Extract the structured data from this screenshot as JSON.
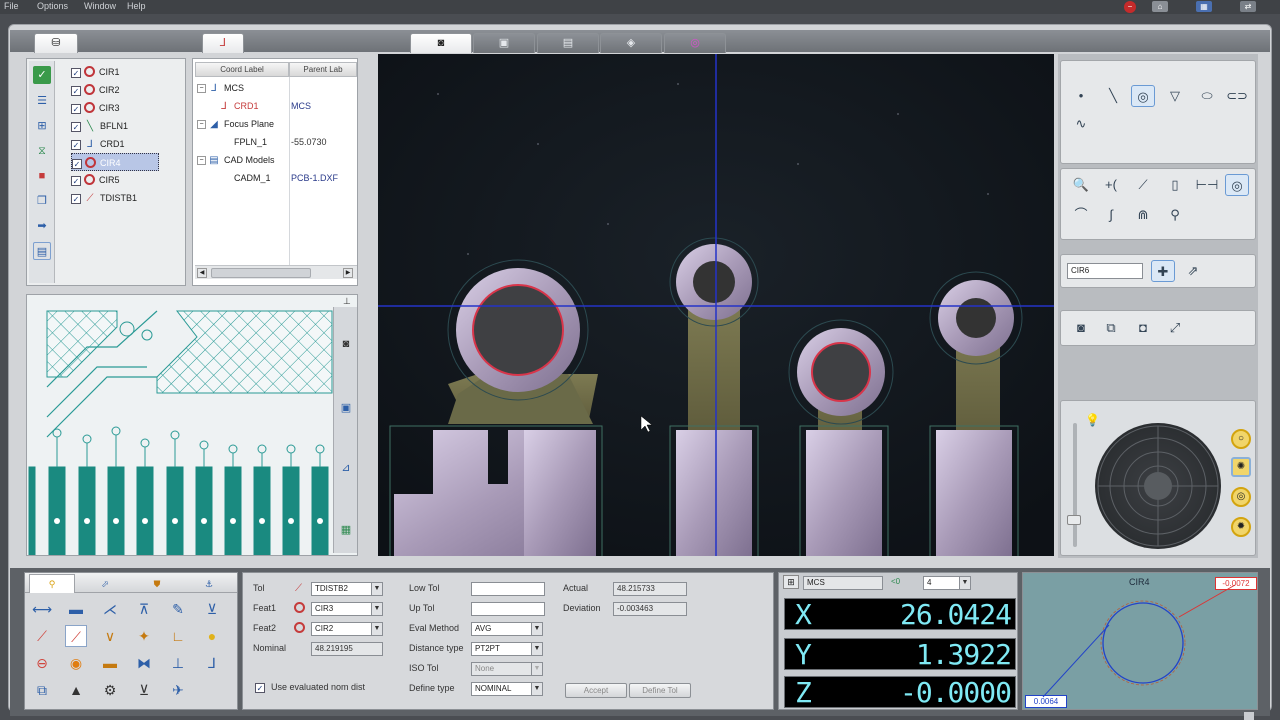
{
  "menu": {
    "items": [
      "File",
      "Options",
      "Window",
      "Help"
    ]
  },
  "left_tabs": [
    "features",
    "coords"
  ],
  "feature_list": [
    {
      "label": "CIR1",
      "type": "circle",
      "checked": true
    },
    {
      "label": "CIR2",
      "type": "circle",
      "checked": true
    },
    {
      "label": "CIR3",
      "type": "circle",
      "checked": true
    },
    {
      "label": "BFLN1",
      "type": "line",
      "checked": true
    },
    {
      "label": "CRD1",
      "type": "coord",
      "checked": true
    },
    {
      "label": "CIR4",
      "type": "circle",
      "checked": true,
      "selected": true
    },
    {
      "label": "CIR5",
      "type": "circle",
      "checked": true
    },
    {
      "label": "TDISTB1",
      "type": "distance",
      "checked": true
    }
  ],
  "coord_table": {
    "headers": [
      "Coord Label",
      "Parent Lab"
    ],
    "rows": [
      {
        "label": "MCS",
        "parent": "",
        "indent": 0,
        "expand": "−"
      },
      {
        "label": "CRD1",
        "parent": "MCS",
        "indent": 1,
        "expand": ""
      },
      {
        "label": "Focus Plane",
        "parent": "",
        "indent": 0,
        "expand": "−"
      },
      {
        "label": "FPLN_1",
        "parent": "-55.0730",
        "indent": 1,
        "expand": ""
      },
      {
        "label": "CAD Models",
        "parent": "",
        "indent": 0,
        "expand": "−"
      },
      {
        "label": "CADM_1",
        "parent": "PCB-1.DXF",
        "indent": 1,
        "expand": ""
      }
    ]
  },
  "right_panel": {
    "feature_name": "CIR6"
  },
  "tolerance_panel": {
    "tol_label": "Tol",
    "tol_value": "TDISTB2",
    "feat1_label": "Feat1",
    "feat1_value": "CIR3",
    "feat2_label": "Feat2",
    "feat2_value": "CIR2",
    "nominal_label": "Nominal",
    "nominal_value": "48.219195",
    "use_eval_label": "Use evaluated nom dist",
    "use_eval_checked": true,
    "low_tol_label": "Low Tol",
    "low_tol_value": "",
    "up_tol_label": "Up Tol",
    "up_tol_value": "",
    "eval_method_label": "Eval Method",
    "eval_method_value": "AVG",
    "distance_type_label": "Distance type",
    "distance_type_value": "PT2PT",
    "iso_tol_label": "ISO Tol",
    "iso_tol_value": "None",
    "define_type_label": "Define type",
    "define_type_value": "NOMINAL",
    "actual_label": "Actual",
    "actual_value": "48.215733",
    "deviation_label": "Deviation",
    "deviation_value": "-0.003463",
    "accept_label": "Accept",
    "define_tol_label": "Define Tol"
  },
  "dro": {
    "coord_system": "MCS",
    "precision": "4",
    "precision_prefix": "<0",
    "x_label": "X",
    "x_value": "26.0424",
    "y_label": "Y",
    "y_value": "1.3922",
    "z_label": "Z",
    "z_value": "-0.0000"
  },
  "fit_view": {
    "title": "CIR4",
    "max_dev": "-0.0072",
    "min_dev": "0.0064"
  },
  "colors": {
    "accent": "#244a8a",
    "dro_text": "#7fe9f4",
    "pcb_teal": "#1a8a80"
  }
}
